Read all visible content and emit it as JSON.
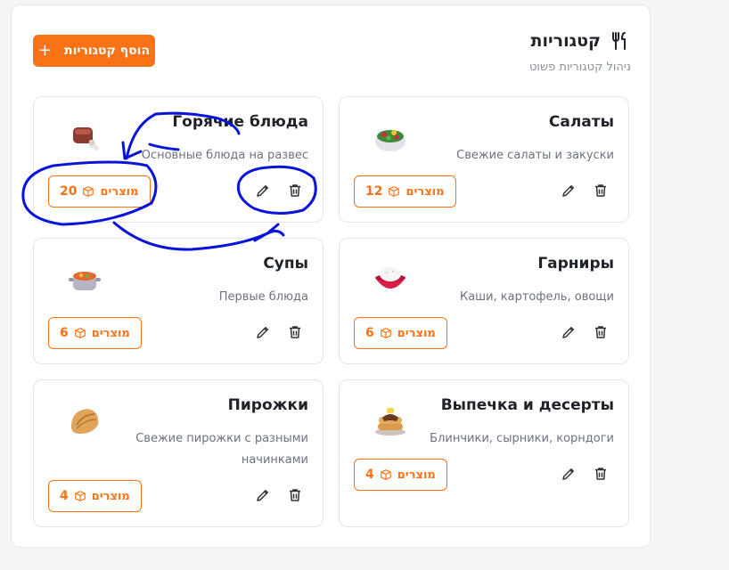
{
  "header": {
    "title": "קטגוריות",
    "subtitle": "ניהול קטגוריות פשוט",
    "add_button_label": "הוסף קטגוריות",
    "title_icon": "fork-knife-icon"
  },
  "categories": [
    {
      "name": "Горячие блюда",
      "description": "Основные блюда на развес",
      "count": "20",
      "count_label": "מוצרים",
      "icon": "meat-icon"
    },
    {
      "name": "Салаты",
      "description": "Свежие салаты и закуски",
      "count": "12",
      "count_label": "מוצרים",
      "icon": "salad-icon"
    },
    {
      "name": "Супы",
      "description": "Первые блюда",
      "count": "6",
      "count_label": "מוצרים",
      "icon": "soup-pot-icon"
    },
    {
      "name": "Гарниры",
      "description": "Каши, картофель, овощи",
      "count": "6",
      "count_label": "מוצרים",
      "icon": "rice-bowl-icon"
    },
    {
      "name": "Пирожки",
      "description": "Свежие пирожки с разными начинками",
      "count": "4",
      "count_label": "מוצרים",
      "icon": "dumpling-icon"
    },
    {
      "name": "Выпечка и десерты",
      "description": "Блинчики, сырники, корндоги",
      "count": "4",
      "count_label": "מוצרים",
      "icon": "pancakes-icon"
    }
  ],
  "colors": {
    "accent": "#f97316",
    "annotation": "#0a14d8"
  }
}
